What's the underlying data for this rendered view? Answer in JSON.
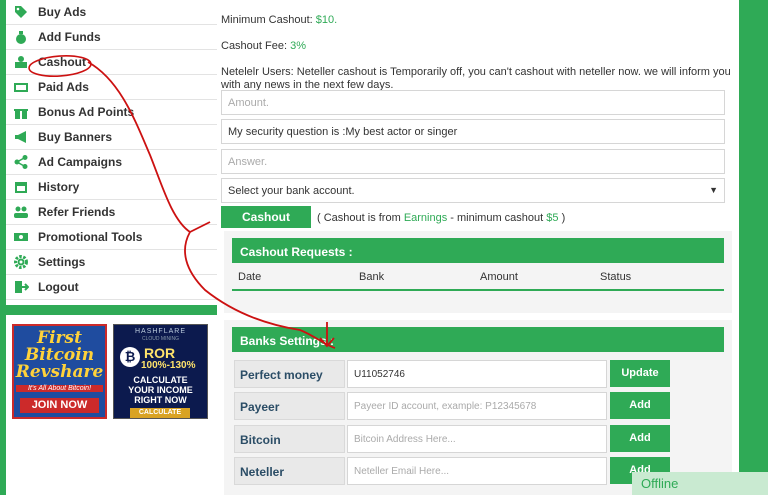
{
  "sidebar": {
    "items": [
      {
        "label": "Buy Ads",
        "icon": "tag-icon"
      },
      {
        "label": "Add Funds",
        "icon": "money-bag-icon"
      },
      {
        "label": "Cashout",
        "icon": "cashout-icon"
      },
      {
        "label": "Paid Ads",
        "icon": "paid-ads-icon"
      },
      {
        "label": "Bonus Ad Points",
        "icon": "gift-icon"
      },
      {
        "label": "Buy Banners",
        "icon": "megaphone-icon"
      },
      {
        "label": "Ad Campaigns",
        "icon": "share-icon"
      },
      {
        "label": "History",
        "icon": "calendar-icon"
      },
      {
        "label": "Refer Friends",
        "icon": "users-icon"
      },
      {
        "label": "Promotional Tools",
        "icon": "money-icon"
      },
      {
        "label": "Settings",
        "icon": "gear-icon"
      },
      {
        "label": "Logout",
        "icon": "logout-icon"
      }
    ]
  },
  "banners": {
    "first": {
      "line1": "First",
      "line2": "Bitcoin",
      "line3": "Revshare",
      "tagline": "It's All About Bitcoin!",
      "cta": "JOIN NOW"
    },
    "second": {
      "brand": "HASHFLARE",
      "sub": "CLOUD MINING",
      "ror": "ROR",
      "percent": "100%-130%",
      "l1": "CALCULATE",
      "l2": "YOUR INCOME",
      "l3": "RIGHT NOW",
      "cta": "CALCULATE"
    }
  },
  "main": {
    "min_cashout_label": "Minimum Cashout:",
    "min_cashout_value": "$10.",
    "fee_label": "Cashout Fee:",
    "fee_value": "3%",
    "notice": "Netelelr Users: Neteller cashout is Temporarily off, you can't cashout with neteller now. we will inform you",
    "notice2": "with any news in the next few days.",
    "amount_placeholder": "Amount.",
    "security_question": "My security question is :My best actor or singer",
    "answer_placeholder": "Answer.",
    "bank_select": "Select your bank account.",
    "cashout_button": "Cashout",
    "note_pre": "( Cashout is from",
    "note_earnings": "Earnings",
    "note_mid": "- minimum cashout",
    "note_amount": "$5",
    "note_post": ")"
  },
  "requests": {
    "title": "Cashout Requests :",
    "columns": [
      "Date",
      "Bank",
      "Amount",
      "Status"
    ]
  },
  "banks": {
    "title": "Banks Settings :",
    "rows": [
      {
        "label": "Perfect money",
        "value": "U11052746",
        "placeholder": "",
        "button": "Update"
      },
      {
        "label": "Payeer",
        "value": "",
        "placeholder": "Payeer ID account, example: P12345678",
        "button": "Add"
      },
      {
        "label": "Bitcoin",
        "value": "",
        "placeholder": "Bitcoin Address Here...",
        "button": "Add"
      },
      {
        "label": "Neteller",
        "value": "",
        "placeholder": "Neteller Email Here...",
        "button": "Add"
      }
    ]
  },
  "chat": {
    "status": "Offline"
  },
  "colors": {
    "accent": "#2faa56",
    "annotation": "#cc1111"
  }
}
